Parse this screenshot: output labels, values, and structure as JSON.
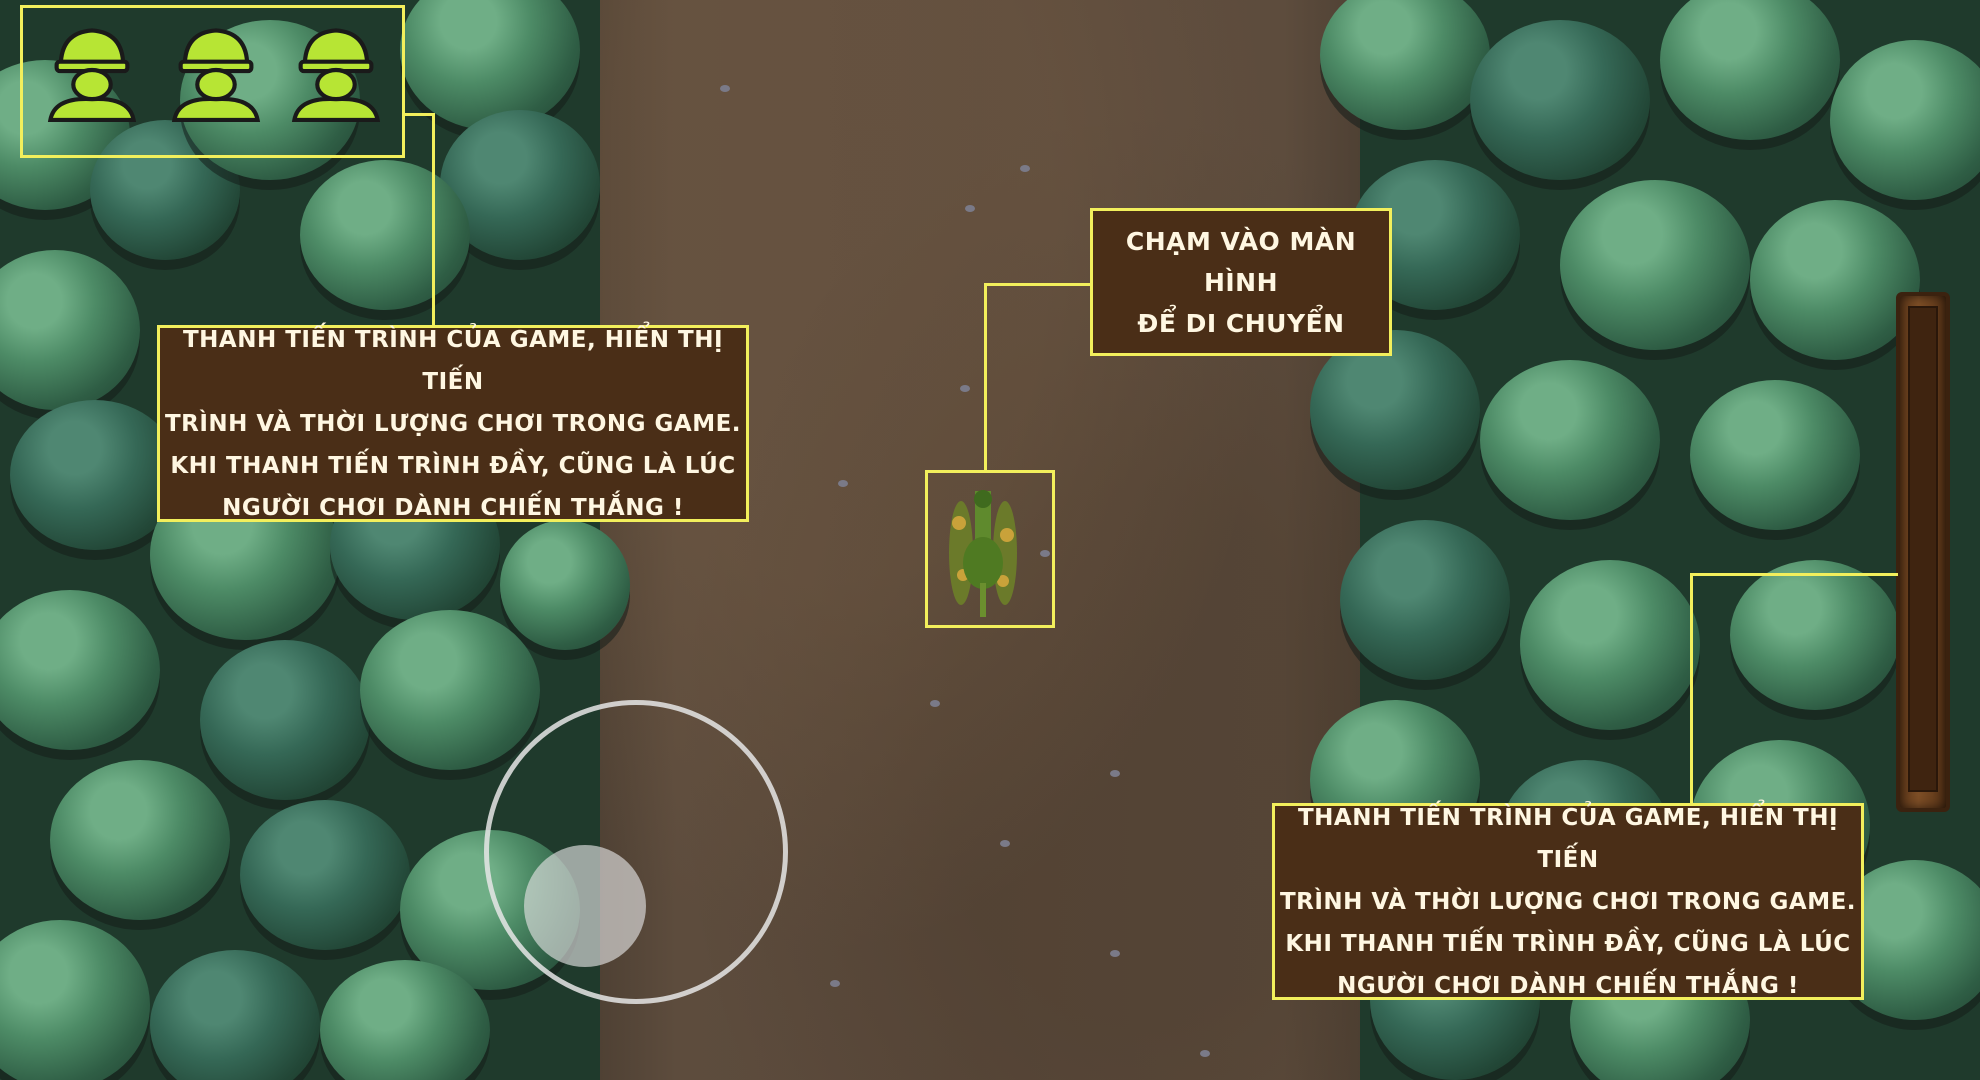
{
  "hud": {
    "lives": [
      {
        "icon": "soldier-life-icon"
      },
      {
        "icon": "soldier-life-icon"
      },
      {
        "icon": "soldier-life-icon"
      }
    ],
    "progress_fraction": 0.0
  },
  "tutorial": {
    "move_hint": {
      "line1": "Chạm vào màn hình",
      "line2": "để di chuyển"
    },
    "progress_hint_left": {
      "line1": "Thanh tiến trình của game, hiển thị tiến",
      "line2": "trình và thời lượng chơi trong game.",
      "line3": "Khi thanh tiến trình đầy, cũng là lúc",
      "line4": "người chơi dành chiến thắng !"
    },
    "progress_hint_right": {
      "line1": "Thanh tiến trình của game, hiển thị tiến",
      "line2": "trình và thời lượng chơi trong game.",
      "line3": "Khi thanh tiến trình đầy, cũng là lúc",
      "line4": "người chơi dành chiến thắng !"
    }
  },
  "colors": {
    "highlight": "#f2ef5c",
    "note_bg": "#4a2e17",
    "note_text": "#fff7e2",
    "soldier": "#b7e534"
  }
}
